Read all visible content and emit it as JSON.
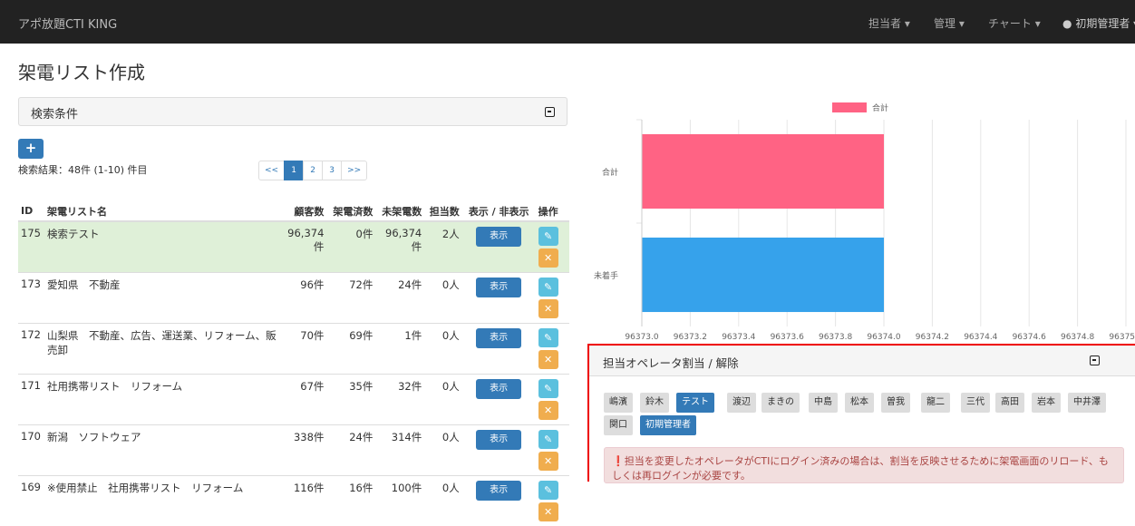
{
  "navbar": {
    "brand": "アポ放題CTI KING",
    "items": [
      "担当者 ▾",
      "管理 ▾",
      "チャート ▾",
      "初期管理者 ▾"
    ]
  },
  "page_title": "架電リスト作成",
  "search": {
    "title": "検索条件"
  },
  "result_text": "検索結果：48件 (1-10) 件目",
  "pagination": [
    "<<",
    "1",
    "2",
    "3",
    ">>"
  ],
  "table": {
    "headers": [
      "ID",
      "架電リスト名",
      "顧客数",
      "架電済数",
      "未架電数",
      "担当数",
      "表示 / 非表示",
      "操作"
    ],
    "show_label": "表示",
    "rows": [
      {
        "id": "175",
        "name": "検索テスト",
        "customers": "96,374件",
        "called": "0件",
        "uncalled": "96,374件",
        "assigned": "2人"
      },
      {
        "id": "173",
        "name": "愛知県　不動産",
        "customers": "96件",
        "called": "72件",
        "uncalled": "24件",
        "assigned": "0人"
      },
      {
        "id": "172",
        "name": "山梨県　不動産、広告、運送業、リフォーム、販売卸",
        "customers": "70件",
        "called": "69件",
        "uncalled": "1件",
        "assigned": "0人"
      },
      {
        "id": "171",
        "name": "社用携帯リスト　リフォーム",
        "customers": "67件",
        "called": "35件",
        "uncalled": "32件",
        "assigned": "0人"
      },
      {
        "id": "170",
        "name": "新潟　ソフトウェア",
        "customers": "338件",
        "called": "24件",
        "uncalled": "314件",
        "assigned": "0人"
      },
      {
        "id": "169",
        "name": "※使用禁止　社用携帯リスト　リフォーム",
        "customers": "116件",
        "called": "16件",
        "uncalled": "100件",
        "assigned": "0人"
      }
    ]
  },
  "chart_data": {
    "type": "bar",
    "orientation": "horizontal",
    "categories": [
      "合計",
      "未着手"
    ],
    "series": [
      {
        "name": "合計",
        "values": [
          96374,
          96374
        ],
        "colors": [
          "#ff6384",
          "#36a2eb"
        ]
      }
    ],
    "xlim": [
      96373.0,
      96375.0
    ],
    "xticks": [
      "96373.0",
      "96373.2",
      "96373.4",
      "96373.6",
      "96373.8",
      "96374.0",
      "96374.2",
      "96374.4",
      "96374.6",
      "96374.8",
      "96375.0"
    ],
    "legend": "top",
    "grid": true
  },
  "operators": {
    "title": "担当オペレータ割当 / 解除",
    "buttons": [
      {
        "label": "嶋濱",
        "selected": false
      },
      {
        "label": "鈴木",
        "selected": false
      },
      {
        "label": "テスト",
        "selected": true
      },
      {
        "label": "渡辺",
        "selected": false
      },
      {
        "label": "まきの",
        "selected": false
      },
      {
        "label": "中島",
        "selected": false
      },
      {
        "label": "松本",
        "selected": false
      },
      {
        "label": "曽我",
        "selected": false
      },
      {
        "label": "龍二",
        "selected": false
      },
      {
        "label": "三代",
        "selected": false
      },
      {
        "label": "高田",
        "selected": false
      },
      {
        "label": "岩本",
        "selected": false
      },
      {
        "label": "中井澤",
        "selected": false
      },
      {
        "label": "関口",
        "selected": false
      },
      {
        "label": "初期管理者",
        "selected": true
      }
    ],
    "alert": "担当を変更したオペレータがCTIにログイン済みの場合は、割当を反映させるために架電画面のリロード、もしくは再ログインが必要です。"
  }
}
